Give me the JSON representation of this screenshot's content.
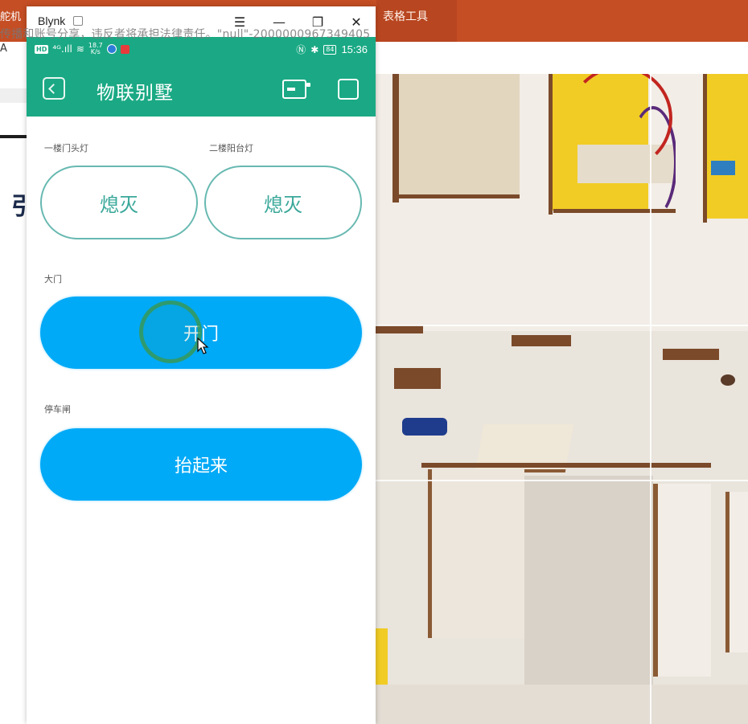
{
  "background": {
    "left_ribbon_text": "舵机",
    "left_a": "A",
    "ribbon_text": "表格工具"
  },
  "watermark": "传播和账号分享，违反者将承担法律责任。\"null\"-2000000967349405",
  "window": {
    "title": "Blynk",
    "menu_glyph": "☰",
    "minimize_glyph": "—",
    "restore_glyph": "❐",
    "close_glyph": "✕"
  },
  "statusbar": {
    "hd_badge": "HD",
    "signal": "⁴ᴳ.ıll",
    "wifi": "≋",
    "net_rate_value": "18.7",
    "net_rate_unit": "K/s",
    "nfc": "Ⓝ",
    "bluetooth": "✱",
    "battery": "84",
    "time": "15:36"
  },
  "appbar": {
    "title": "物联别墅"
  },
  "widgets": {
    "light1_label": "一楼门头灯",
    "light1_state": "熄灭",
    "light2_label": "二楼阳台灯",
    "light2_state": "熄灭",
    "door_label": "大门",
    "door_button": "开门",
    "gate_label": "停车闸",
    "gate_button": "抬起来"
  },
  "colors": {
    "app_green": "#1aa984",
    "button_blue": "#00aaf7",
    "outline_teal": "#67b9b1",
    "ribbon_orange": "#c54e24"
  }
}
